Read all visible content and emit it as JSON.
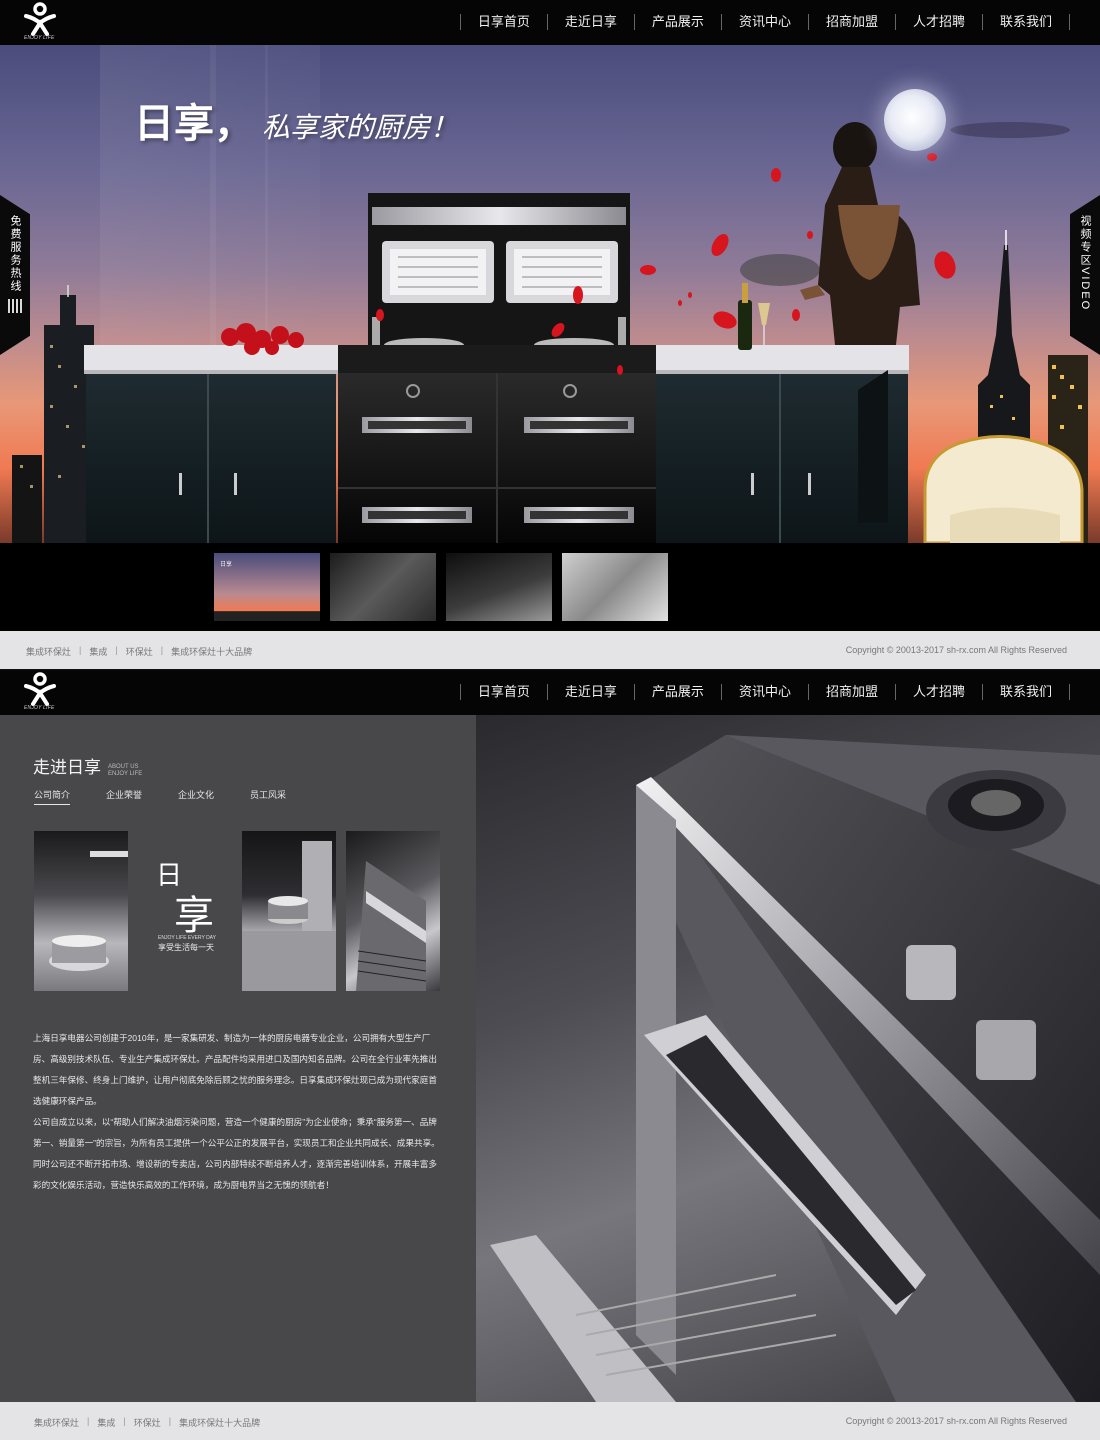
{
  "brand": {
    "tagline": "ENJOY LIFE",
    "colors": {
      "nav_bg": "#050505",
      "footer_bg": "#e4e4e6",
      "panel_bg": "#48484a",
      "accent_rose": "#c4101a"
    }
  },
  "nav": {
    "items": [
      "日享首页",
      "走近日享",
      "产品展示",
      "资讯中心",
      "招商加盟",
      "人才招聘",
      "联系我们"
    ]
  },
  "hero": {
    "slogan_main": "日享，",
    "slogan_sub": "私享家的厨房！",
    "left_tab": "免费服务热线",
    "right_tab": "视频专区VIDEO"
  },
  "thumbnails": [
    {
      "caption": "日享",
      "label": "thumb-1"
    },
    {
      "caption": "",
      "label": "thumb-2"
    },
    {
      "caption": "",
      "label": "thumb-3"
    },
    {
      "caption": "",
      "label": "thumb-4"
    }
  ],
  "footer": {
    "links": [
      "集成环保灶",
      "集成",
      "环保灶",
      "集成环保灶十大品牌"
    ],
    "copyright": "Copyright © 20013-2017 sh-rx.com All Rights Reserved"
  },
  "about": {
    "title": "走进日享",
    "title_en_1": "ABOUT US",
    "title_en_2": "ENJOY LIFE",
    "tabs": [
      "公司简介",
      "企业荣誉",
      "企业文化",
      "员工风采"
    ],
    "logo_char_1": "日",
    "logo_char_2": "享",
    "logo_en": "ENJOY LIFE EVERY DAY",
    "logo_cn": "享受生活每一天",
    "paragraph_1": "上海日享电器公司创建于2010年，是一家集研发、制造为一体的厨房电器专业企业，公司拥有大型生产厂房、高级别技术队伍、专业生产集成环保灶。产品配件均采用进口及国内知名品牌。公司在全行业率先推出整机三年保修、终身上门维护，让用户彻底免除后顾之忧的服务理念。日享集成环保灶现已成为现代家庭首选健康环保产品。",
    "paragraph_2": "公司自成立以来，以“帮助人们解决油烟污染问题，营造一个健康的厨房”为企业使命；秉承“服务第一、品牌第一、销量第一”的宗旨，为所有员工提供一个公平公正的发展平台，实现员工和企业共同成长、成果共享。同时公司还不断开拓市场、增设新的专卖店，公司内部特续不断培养人才，逐渐完善培训体系，开展丰富多彩的文化娱乐活动，营造快乐高效的工作环境，成为厨电界当之无愧的领航者！"
  }
}
